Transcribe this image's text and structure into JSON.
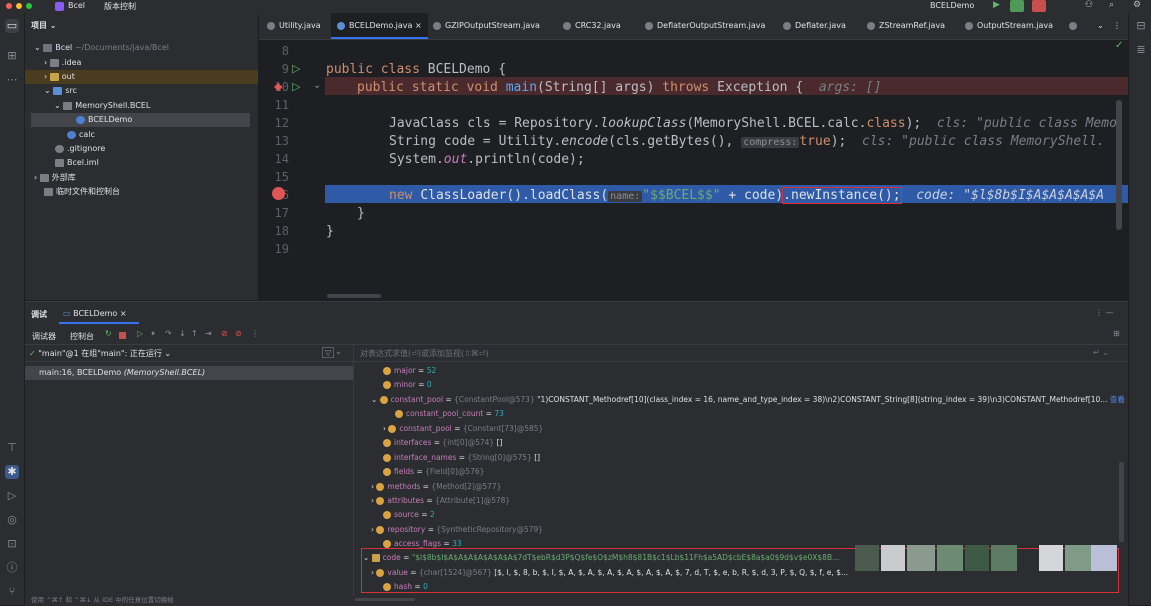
{
  "titlebar": {
    "project": "Bcel",
    "vcs": "版本控制",
    "run_config": "BCELDemo"
  },
  "project_panel": {
    "title": "项目",
    "items": [
      {
        "label": "Bcel",
        "extra": "~/Documents/java/Bcel"
      },
      {
        "label": ".idea"
      },
      {
        "label": "out"
      },
      {
        "label": "src"
      },
      {
        "label": "MemoryShell.BCEL"
      },
      {
        "label": "BCELDemo"
      },
      {
        "label": "calc"
      },
      {
        "label": ".gitignore"
      },
      {
        "label": "Bcel.iml"
      },
      {
        "label": "外部库"
      },
      {
        "label": "临时文件和控制台"
      }
    ]
  },
  "tabs": [
    "Utility.java",
    "BCELDemo.java",
    "GZIPOutputStream.java",
    "CRC32.java",
    "DeflaterOutputStream.java",
    "Deflater.java",
    "ZStreamRef.java",
    "OutputStream.java"
  ],
  "editor": {
    "line_numbers": [
      "8",
      "9",
      "10",
      "11",
      "12",
      "13",
      "14",
      "15",
      "16",
      "17",
      "18",
      "19"
    ],
    "l9_a": "public class ",
    "l9_b": "BCELDemo {",
    "l10_a": "public static void ",
    "l10_b": "main",
    "l10_c": "(String[] args) ",
    "l10_d": "throws ",
    "l10_e": "Exception {",
    "l10_hint": "args: []",
    "l12_a": "JavaClass cls = Repository.",
    "l12_b": "lookupClass",
    "l12_c": "(MemoryShell.BCEL.calc.",
    "l12_d": "class",
    "l12_e": ");",
    "l12_hint": "cls: \"public class Memo",
    "l13_a": "String code = Utility.",
    "l13_b": "encode",
    "l13_c": "(cls.getBytes(), ",
    "l13_inlay": "compress:",
    "l13_d": "true",
    "l13_e": ");",
    "l13_hint": "cls: \"public class MemoryShell.",
    "l14_a": "System.",
    "l14_b": "out",
    "l14_c": ".println(code);",
    "l16_a": "new ",
    "l16_b": "ClassLoader().loadClass(",
    "l16_inlay": "name:",
    "l16_str": "\"$$BCEL$$\"",
    "l16_c": " + code)",
    "l16_d": ".newInstance();",
    "l16_hint": "code: \"$l$8b$I$A$A$A$A$A",
    "l17": "}",
    "l18": "}"
  },
  "debug": {
    "tab_debug": "调试",
    "tab_session": "BCELDemo",
    "subtab_debugger": "调试器",
    "subtab_console": "控制台",
    "thread": "\"main\"@1 在组\"main\": 正在运行",
    "frame_a": "main:16, BCELDemo ",
    "frame_b": "(MemoryShell.BCEL)",
    "eval_placeholder": "对表达式求值(⏎)或添加监视(⇧⌘⏎)",
    "status": "使用 ⌃⌘↑ 和 ⌃⌘↓ 从 IDE 中的任意位置切换帧"
  },
  "variables": [
    {
      "name": "major",
      "type": "",
      "value": "52"
    },
    {
      "name": "minor",
      "type": "",
      "value": "0"
    },
    {
      "name": "constant_pool",
      "type": "{ConstantPool@573}",
      "value": "\"1)CONSTANT_Methodref[10](class_index = 16, name_and_type_index = 38)\\n2)CONSTANT_String[8](string_index = 39)\\n3)CONSTANT_Methodref[10...",
      "more": "查看"
    },
    {
      "name": "constant_pool_count",
      "type": "",
      "value": "73"
    },
    {
      "name": "constant_pool",
      "type": "{Constant[73]@585}",
      "value": ""
    },
    {
      "name": "interfaces",
      "type": "{int[0]@574}",
      "value": "[]"
    },
    {
      "name": "interface_names",
      "type": "{String[0]@575}",
      "value": "[]"
    },
    {
      "name": "fields",
      "type": "{Field[0]@576}",
      "value": ""
    },
    {
      "name": "methods",
      "type": "{Method[2]@577}",
      "value": ""
    },
    {
      "name": "attributes",
      "type": "{Attribute[1]@578}",
      "value": ""
    },
    {
      "name": "source",
      "type": "",
      "value": "2"
    },
    {
      "name": "repository",
      "type": "{SyntheticRepository@579}",
      "value": ""
    },
    {
      "name": "access_flags",
      "type": "",
      "value": "33"
    },
    {
      "name": "code",
      "type": "",
      "value": "\"$l$8b$I$A$A$A$A$A$A$A$7dT$ebR$d3P$Q$fe$O$zM$h8$81B$c1$Lb$11Fh$a5AD$cbE$8a$a0$9d$v$e0X$8B..."
    },
    {
      "name": "value",
      "type": "{char[1524]@567}",
      "value": "[$, l, $, 8, b, $, I, $, A, $, A, $, A, $, A, $, A, $, A, $, 7, d, T, $, e, b, R, $, d, 3, P, $, Q, $, f, e, $..."
    },
    {
      "name": "hash",
      "type": "",
      "value": "0"
    }
  ]
}
